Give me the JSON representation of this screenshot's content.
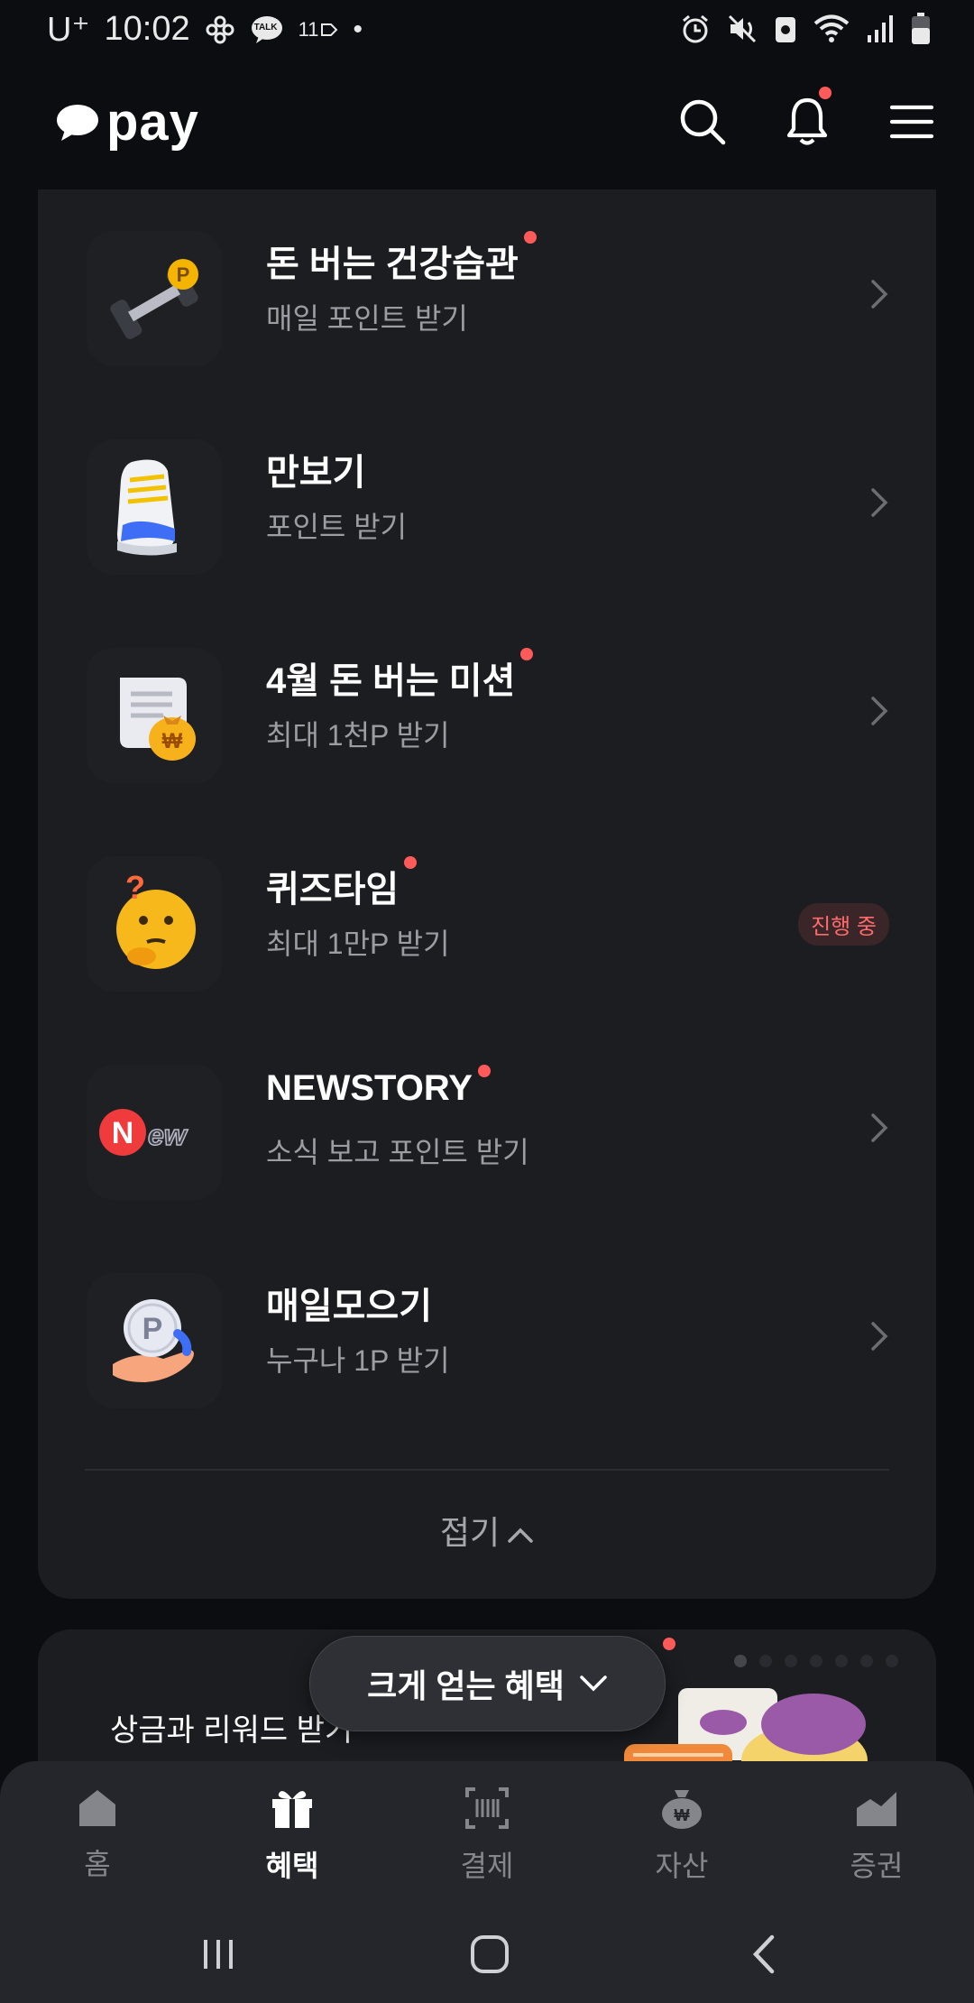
{
  "status_bar": {
    "carrier": "U⁺",
    "time": "10:02",
    "talk_label": "TALK",
    "notif_count": "11",
    "icons": [
      "flower-icon",
      "talk-icon",
      "tag-icon",
      "dot-icon",
      "alarm-icon",
      "mute-icon",
      "saver-icon",
      "wifi-icon",
      "signal-icon",
      "battery-icon"
    ]
  },
  "header": {
    "logo_text": "pay",
    "icons": [
      "search-icon",
      "bell-icon",
      "menu-icon"
    ],
    "bell_has_dot": true
  },
  "benefits": [
    {
      "title": "돈 버는 건강습관",
      "subtitle": "매일 포인트 받기",
      "dot": true,
      "icon": "dumbbell-icon",
      "badge": ""
    },
    {
      "title": "만보기",
      "subtitle": "포인트 받기",
      "dot": false,
      "icon": "sneaker-icon",
      "badge": ""
    },
    {
      "title": "4월 돈 버는 미션",
      "subtitle": "최대 1천P 받기",
      "dot": true,
      "icon": "scroll-moneybag-icon",
      "badge": ""
    },
    {
      "title": "퀴즈타임",
      "subtitle": "최대 1만P 받기",
      "dot": true,
      "icon": "thinking-face-icon",
      "badge": "진행 중"
    },
    {
      "title": "NEWSTORY",
      "subtitle": "소식 보고 포인트 받기",
      "dot": true,
      "icon": "new-icon",
      "badge": ""
    },
    {
      "title": "매일모으기",
      "subtitle": "누구나 1P 받기",
      "dot": false,
      "icon": "coin-hand-icon",
      "badge": ""
    }
  ],
  "collapse_label": "접기",
  "promo": {
    "text": "상금과 리워드 받기",
    "float_label": "크게 얻는 혜택"
  },
  "bottom_nav": [
    {
      "label": "홈",
      "icon": "home-icon",
      "active": false
    },
    {
      "label": "혜택",
      "icon": "gift-icon",
      "active": true
    },
    {
      "label": "결제",
      "icon": "barcode-icon",
      "active": false
    },
    {
      "label": "자산",
      "icon": "moneybag-icon",
      "active": false
    },
    {
      "label": "증권",
      "icon": "chart-icon",
      "active": false
    }
  ],
  "colors": {
    "background": "#0c0d10",
    "card": "#1c1d21",
    "accent_dot": "#ff5a5a",
    "subtitle": "#9c9da3"
  }
}
